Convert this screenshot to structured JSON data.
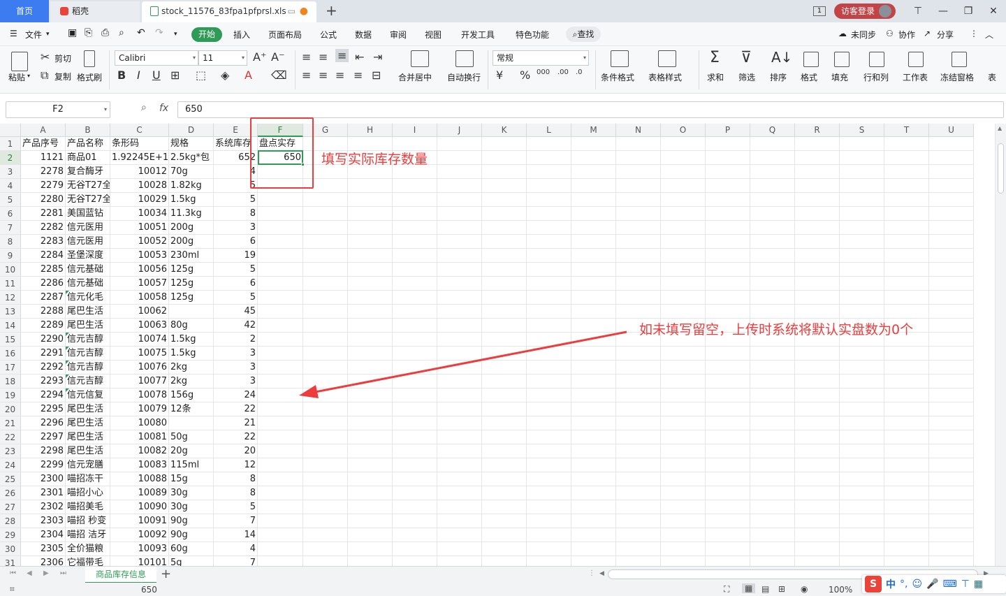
{
  "tabs": {
    "home": "首页",
    "daoke": "稻壳",
    "file": "stock_11576_83fpa1pfprsl.xls",
    "badge": "1",
    "login": "访客登录"
  },
  "menu": {
    "file": "文件",
    "items": [
      "开始",
      "插入",
      "页面布局",
      "公式",
      "数据",
      "审阅",
      "视图",
      "开发工具",
      "特色功能"
    ],
    "search": "查找",
    "sync": "未同步",
    "collab": "协作",
    "share": "分享"
  },
  "ribbon": {
    "paste": "粘贴",
    "cut": "剪切",
    "copy": "复制",
    "format_painter": "格式刷",
    "font_name": "Calibri",
    "font_size": "11",
    "merge": "合并居中",
    "wrap": "自动换行",
    "number_format": "常规",
    "cond_format": "条件格式",
    "table_style": "表格样式",
    "sum": "求和",
    "filter": "筛选",
    "sort": "排序",
    "format": "格式",
    "fill": "填充",
    "rowcol": "行和列",
    "sheet": "工作表",
    "freeze": "冻结窗格",
    "more": "表"
  },
  "formula_bar": {
    "cell_ref": "F2",
    "fx": "fx",
    "value": "650"
  },
  "columns": [
    "A",
    "B",
    "C",
    "D",
    "E",
    "F",
    "G",
    "H",
    "I",
    "J",
    "K",
    "L",
    "M",
    "N",
    "O",
    "P",
    "Q",
    "R",
    "S",
    "T",
    "U"
  ],
  "header_row": [
    "产品序号",
    "产品名称",
    "条形码",
    "规格",
    "系统库存",
    "盘点实存"
  ],
  "rows": [
    [
      "1121",
      "商品01",
      "1.92245E+12",
      "2.5kg*包",
      "652",
      "650"
    ],
    [
      "2278",
      "复合酶牙",
      "10012",
      "70g",
      "4",
      ""
    ],
    [
      "2279",
      "无谷T27全",
      "10028",
      "1.82kg",
      "5",
      ""
    ],
    [
      "2280",
      "无谷T27全",
      "10029",
      "1.5kg",
      "5",
      ""
    ],
    [
      "2281",
      "美国蓝钻",
      "10034",
      "11.3kg",
      "8",
      ""
    ],
    [
      "2282",
      "信元医用",
      "10051",
      "200g",
      "3",
      ""
    ],
    [
      "2283",
      "信元医用",
      "10052",
      "200g",
      "6",
      ""
    ],
    [
      "2284",
      "圣堡深度",
      "10053",
      "230ml",
      "19",
      ""
    ],
    [
      "2285",
      "信元基础",
      "10056",
      "125g",
      "5",
      ""
    ],
    [
      "2286",
      "信元基础",
      "10057",
      "125g",
      "6",
      ""
    ],
    [
      "2287",
      "信元化毛",
      "10058",
      "125g",
      "5",
      ""
    ],
    [
      "2288",
      "尾巴生活",
      "10062",
      "",
      "45",
      ""
    ],
    [
      "2289",
      "尾巴生活",
      "10063",
      "80g",
      "42",
      ""
    ],
    [
      "2290",
      "信元吉醇",
      "10074",
      "1.5kg",
      "2",
      ""
    ],
    [
      "2291",
      "信元吉醇",
      "10075",
      "1.5kg",
      "3",
      ""
    ],
    [
      "2292",
      "信元吉醇",
      "10076",
      "2kg",
      "3",
      ""
    ],
    [
      "2293",
      "信元吉醇",
      "10077",
      "2kg",
      "3",
      ""
    ],
    [
      "2294",
      "信元信复",
      "10078",
      "156g",
      "24",
      ""
    ],
    [
      "2295",
      "尾巴生活",
      "10079",
      "12条",
      "22",
      ""
    ],
    [
      "2296",
      "尾巴生活",
      "10080",
      "",
      "21",
      ""
    ],
    [
      "2297",
      "尾巴生活",
      "10081",
      "50g",
      "22",
      ""
    ],
    [
      "2298",
      "尾巴生活",
      "10082",
      "20g",
      "20",
      ""
    ],
    [
      "2299",
      "信元宠膳",
      "10083",
      "115ml",
      "12",
      ""
    ],
    [
      "2300",
      "喵招冻干",
      "10088",
      "15g",
      "8",
      ""
    ],
    [
      "2301",
      "喵招小心",
      "10089",
      "30g",
      "8",
      ""
    ],
    [
      "2302",
      "喵招美毛",
      "10090",
      "30g",
      "5",
      ""
    ],
    [
      "2303",
      "喵招 秒变",
      "10091",
      "90g",
      "7",
      ""
    ],
    [
      "2304",
      "喵招 洁牙",
      "10092",
      "90g",
      "14",
      ""
    ],
    [
      "2305",
      "全价猫粮",
      "10093",
      "60g",
      "4",
      ""
    ],
    [
      "2306",
      "它福带毛",
      "10101",
      "5g",
      "7",
      ""
    ]
  ],
  "annotations": {
    "fill_hint": "填写实际库存数量",
    "empty_hint": "如未填写留空，上传时系统将默认实盘数为0个"
  },
  "sheet_tab": "商品库存信息",
  "status": {
    "value": "650",
    "zoom": "100%"
  },
  "ime": {
    "logo": "S",
    "mode": "中"
  },
  "colors": {
    "accent_green": "#2e9b57",
    "annotation_red": "#ee3b3b",
    "home_tab_blue": "#3c7bf0"
  }
}
